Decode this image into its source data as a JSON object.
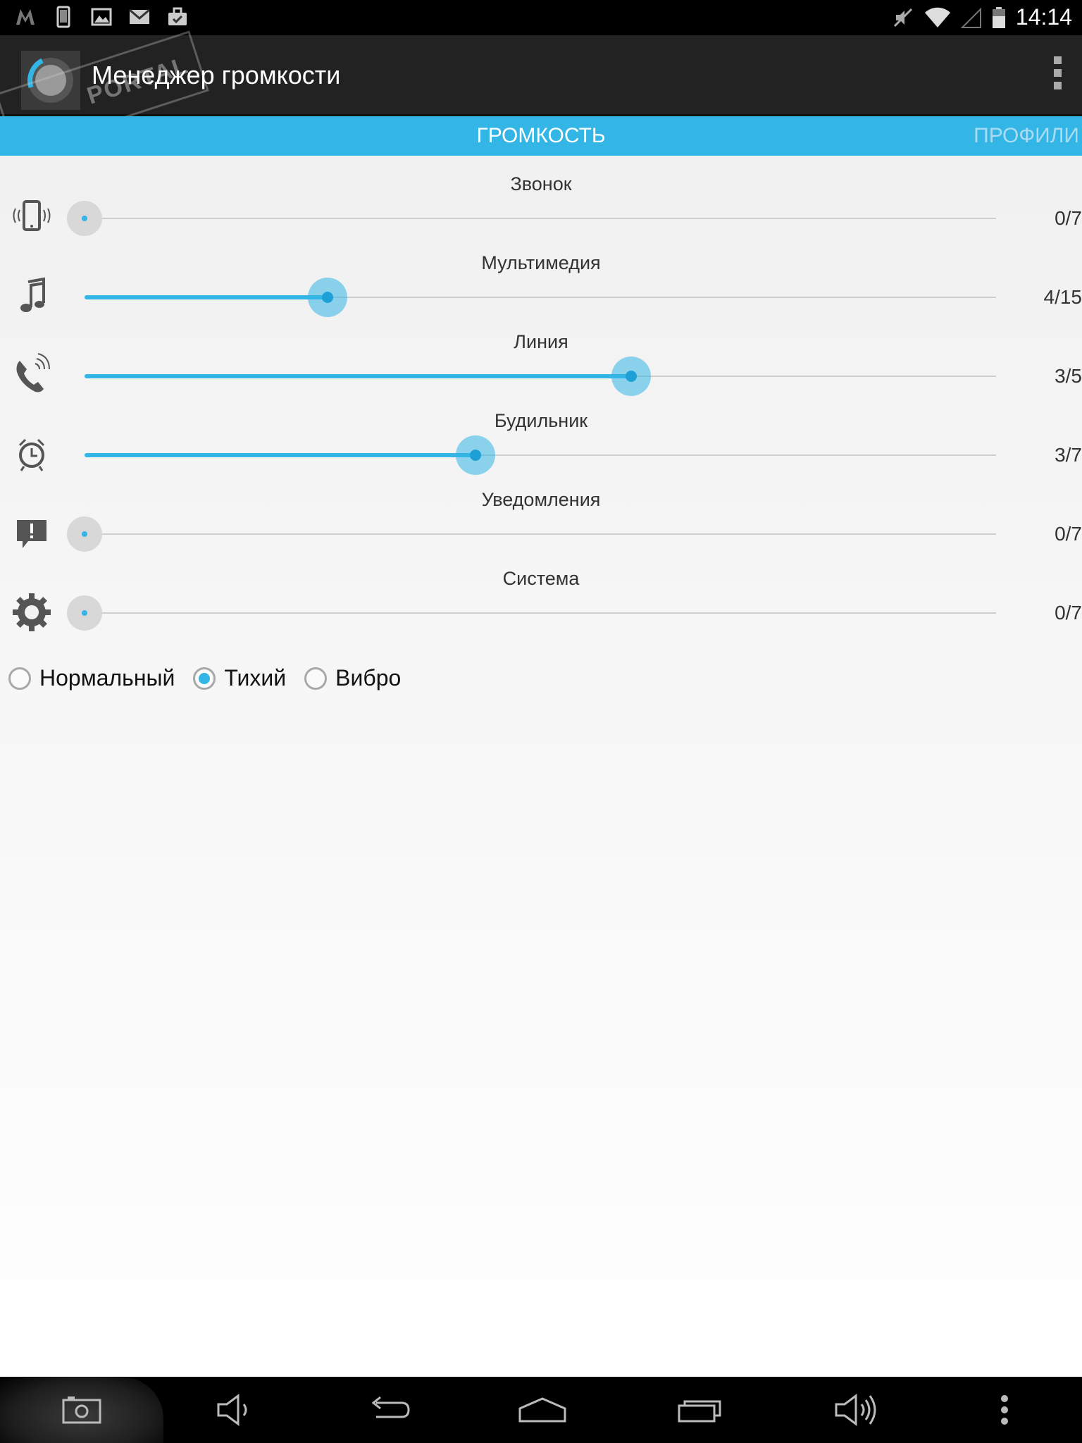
{
  "status_bar": {
    "time": "14:14",
    "left_icons": [
      "notif-m-icon",
      "phone-icon",
      "image-icon",
      "gmail-icon",
      "briefcase-icon"
    ],
    "right_icons": [
      "mute-icon",
      "wifi-icon",
      "signal-icon",
      "battery-icon"
    ]
  },
  "action_bar": {
    "title": "Менеджер громкости",
    "watermark": "PORTAL"
  },
  "tabs": {
    "active": "ГРОМКОСТЬ",
    "next": "ПРОФИЛИ"
  },
  "volumes": [
    {
      "label": "Звонок",
      "value_text": "0/7",
      "level": 0,
      "max": 7,
      "icon": "vibrating-phone-icon"
    },
    {
      "label": "Мультимедия",
      "value_text": "4/15",
      "level": 4,
      "max": 15,
      "icon": "music-note-icon"
    },
    {
      "label": "Линия",
      "value_text": "3/5",
      "level": 3,
      "max": 5,
      "icon": "phone-call-icon"
    },
    {
      "label": "Будильник",
      "value_text": "3/7",
      "level": 3,
      "max": 7,
      "icon": "alarm-clock-icon"
    },
    {
      "label": "Уведомления",
      "value_text": "0/7",
      "level": 0,
      "max": 7,
      "icon": "notification-icon"
    },
    {
      "label": "Система",
      "value_text": "0/7",
      "level": 0,
      "max": 7,
      "icon": "gear-icon"
    }
  ],
  "ringer_mode": {
    "options": [
      "Нормальный",
      "Тихий",
      "Вибро"
    ],
    "selected": "Тихий"
  },
  "nav_bar": {
    "icons": [
      "screenshot-icon",
      "volume-down-icon",
      "back-icon",
      "home-icon",
      "recent-apps-icon",
      "volume-up-icon",
      "menu-icon"
    ]
  },
  "colors": {
    "accent": "#33b5e5",
    "action_bar": "#222222",
    "status_bar": "#000000"
  }
}
